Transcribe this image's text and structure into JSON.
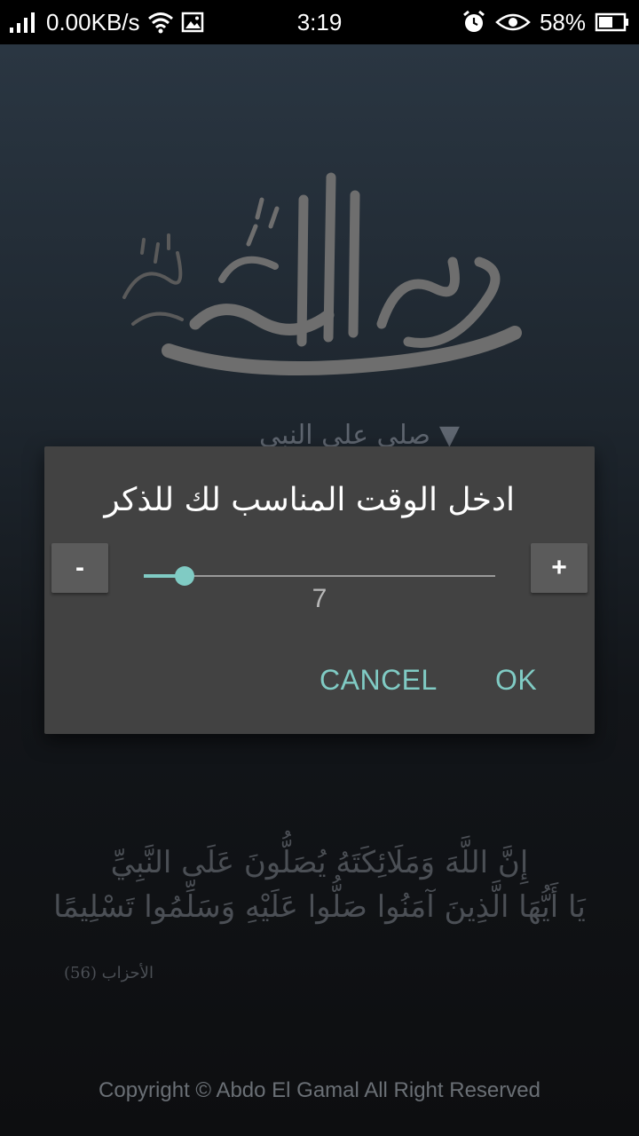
{
  "status_bar": {
    "network_speed": "0.00KB/s",
    "time": "3:19",
    "battery_percent": "58%",
    "icons": [
      "signal-icon",
      "wifi-icon",
      "image-icon",
      "alarm-icon",
      "eye-icon",
      "battery-icon"
    ]
  },
  "background": {
    "dropdown_label": "صلى على النبي",
    "ayah_line1": "إِنَّ اللَّهَ وَمَلَائِكَتَهُ يُصَلُّونَ عَلَى النَّبِيِّ",
    "ayah_line2": "يَا أَيُّهَا الَّذِينَ آمَنُوا صَلُّوا عَلَيْهِ وَسَلِّمُوا تَسْلِيمًا",
    "ayah_reference": "الأحزاب (56)",
    "copyright": "Copyright © Abdo El Gamal All Right Reserved"
  },
  "dialog": {
    "title": "ادخل الوقت المناسب لك للذكر",
    "minus_label": "-",
    "plus_label": "+",
    "slider_value": "7",
    "slider_fraction": 0.115,
    "cancel_label": "CANCEL",
    "ok_label": "OK"
  },
  "colors": {
    "accent": "#80cbc4",
    "dialog_bg": "#424242",
    "status_bar_bg": "#000000"
  }
}
